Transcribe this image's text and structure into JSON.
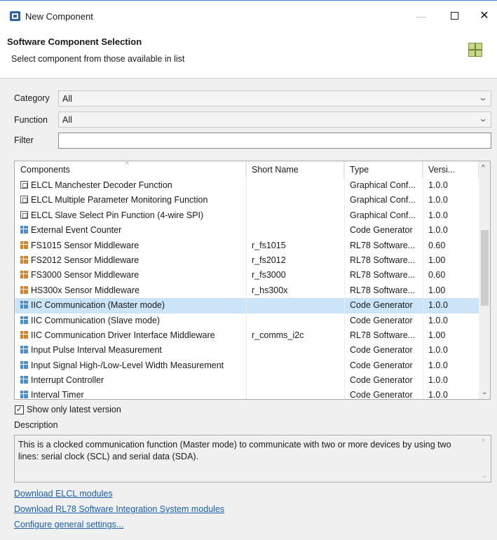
{
  "window": {
    "title": "New Component",
    "minimize_glyph": "—",
    "close_glyph": "✕"
  },
  "header": {
    "title": "Software Component Selection",
    "subtitle": "Select component from those available in list"
  },
  "filters": {
    "category_label": "Category",
    "category_value": "All",
    "function_label": "Function",
    "function_value": "All",
    "filter_label": "Filter",
    "filter_value": ""
  },
  "table": {
    "columns": [
      "Components",
      "Short Name",
      "Type",
      "Versi..."
    ],
    "rows": [
      {
        "icon": "graphical-config-icon",
        "component": "ELCL Manchester Decoder Function",
        "short_name": "",
        "type": "Graphical Conf...",
        "version": "1.0.0"
      },
      {
        "icon": "graphical-config-icon",
        "component": "ELCL Multiple Parameter Monitoring Function",
        "short_name": "",
        "type": "Graphical Conf...",
        "version": "1.0.0"
      },
      {
        "icon": "graphical-config-icon",
        "component": "ELCL Slave Select Pin Function (4-wire SPI)",
        "short_name": "",
        "type": "Graphical Conf...",
        "version": "1.0.0"
      },
      {
        "icon": "code-generator-icon",
        "component": "External Event Counter",
        "short_name": "",
        "type": "Code Generator",
        "version": "1.0.0"
      },
      {
        "icon": "rl78-software-icon",
        "component": "FS1015 Sensor Middleware",
        "short_name": "r_fs1015",
        "type": "RL78 Software...",
        "version": "0.60"
      },
      {
        "icon": "rl78-software-icon",
        "component": "FS2012 Sensor Middleware",
        "short_name": "r_fs2012",
        "type": "RL78 Software...",
        "version": "1.00"
      },
      {
        "icon": "rl78-software-icon",
        "component": "FS3000 Sensor Middleware",
        "short_name": "r_fs3000",
        "type": "RL78 Software...",
        "version": "0.60"
      },
      {
        "icon": "rl78-software-icon",
        "component": "HS300x Sensor Middleware",
        "short_name": "r_hs300x",
        "type": "RL78 Software...",
        "version": "1.00"
      },
      {
        "icon": "code-generator-icon",
        "component": "IIC Communication (Master mode)",
        "short_name": "",
        "type": "Code Generator",
        "version": "1.0.0",
        "selected": true
      },
      {
        "icon": "code-generator-icon",
        "component": "IIC Communication (Slave mode)",
        "short_name": "",
        "type": "Code Generator",
        "version": "1.0.0"
      },
      {
        "icon": "rl78-software-icon",
        "component": "IIC Communication Driver Interface Middleware",
        "short_name": "r_comms_i2c",
        "type": "RL78 Software...",
        "version": "1.00"
      },
      {
        "icon": "code-generator-icon",
        "component": "Input Pulse Interval Measurement",
        "short_name": "",
        "type": "Code Generator",
        "version": "1.0.0"
      },
      {
        "icon": "code-generator-icon",
        "component": "Input Signal High-/Low-Level Width Measurement",
        "short_name": "",
        "type": "Code Generator",
        "version": "1.0.0"
      },
      {
        "icon": "code-generator-icon",
        "component": "Interrupt Controller",
        "short_name": "",
        "type": "Code Generator",
        "version": "1.0.0"
      },
      {
        "icon": "code-generator-icon",
        "component": "Interval Timer",
        "short_name": "",
        "type": "Code Generator",
        "version": "1.0.0"
      }
    ]
  },
  "options": {
    "show_latest_label": "Show only latest version",
    "show_latest_checked": true
  },
  "description": {
    "label": "Description",
    "text": "This is a clocked communication function (Master mode) to communicate with two or more devices by using two lines: serial clock (SCL) and serial data (SDA)."
  },
  "links": [
    "Download ELCL modules",
    "Download RL78 Software Integration System modules",
    "Configure general settings..."
  ],
  "colors": {
    "selection": "#cce4f7",
    "link": "#1a5fb4",
    "code_generator_icon": "#4a8fd6",
    "rl78_icon": "#d9822b"
  }
}
